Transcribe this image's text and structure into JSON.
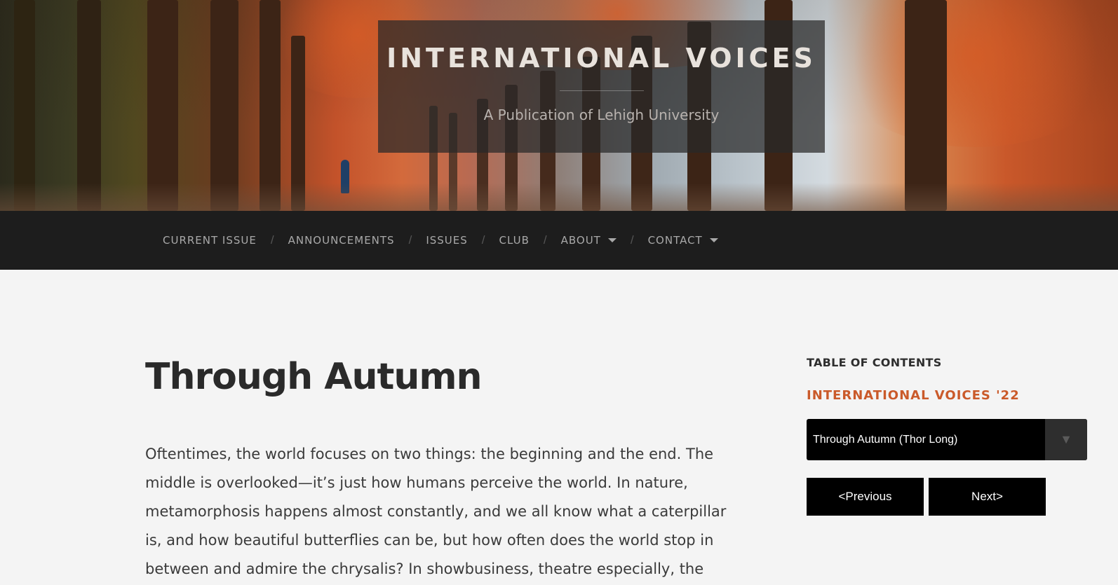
{
  "header": {
    "site_title": "INTERNATIONAL VOICES",
    "tagline": "A Publication of Lehigh University"
  },
  "nav": {
    "items": [
      {
        "label": "CURRENT ISSUE",
        "has_dropdown": false
      },
      {
        "label": "ANNOUNCEMENTS",
        "has_dropdown": false
      },
      {
        "label": "ISSUES",
        "has_dropdown": false
      },
      {
        "label": "CLUB",
        "has_dropdown": false
      },
      {
        "label": "ABOUT",
        "has_dropdown": true
      },
      {
        "label": "CONTACT",
        "has_dropdown": true
      }
    ],
    "separator": "/"
  },
  "post": {
    "title": "Through Autumn",
    "body": "Oftentimes, the world focuses on two things: the beginning and the end. The middle is overlooked—it’s just how humans perceive the world. In nature, metamorphosis happens almost constantly, and we all know what a caterpillar is, and how beautiful butterflies can be, but how often does the world stop in between and admire the chrysalis? In showbusiness, theatre especially, the"
  },
  "sidebar": {
    "toc_heading": "TABLE OF CONTENTS",
    "issue_title": "INTERNATIONAL VOICES '22",
    "select_value": "Through Autumn (Thor Long)",
    "prev_label": "<Previous",
    "next_label": "Next>"
  },
  "colors": {
    "nav_bg": "#1d1d1d",
    "accent": "#ca5a2a",
    "page_bg": "#f4f4f4"
  }
}
